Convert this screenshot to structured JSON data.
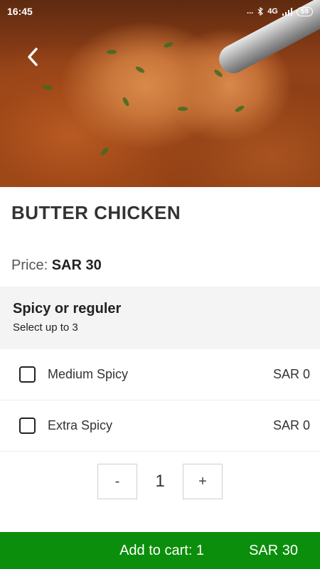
{
  "status_bar": {
    "time": "16:45",
    "dots": "...",
    "network": "4G",
    "battery": "59"
  },
  "hero": {
    "image_icon": "food-photo"
  },
  "nav": {
    "back_icon": "chevron-left-icon"
  },
  "item": {
    "name": "BUTTER CHICKEN",
    "price_label": "Price:",
    "price_value": "SAR 30"
  },
  "option_group": {
    "title": "Spicy or reguler",
    "subtitle": "Select up to 3",
    "options": [
      {
        "label": "Medium Spicy",
        "price": "SAR 0",
        "checked": false
      },
      {
        "label": "Extra Spicy",
        "price": "SAR 0",
        "checked": false
      }
    ]
  },
  "quantity": {
    "minus": "-",
    "value": "1",
    "plus": "+"
  },
  "cart": {
    "label": "Add to cart: 1",
    "total": "SAR 30",
    "color": "#0b8e0b"
  }
}
